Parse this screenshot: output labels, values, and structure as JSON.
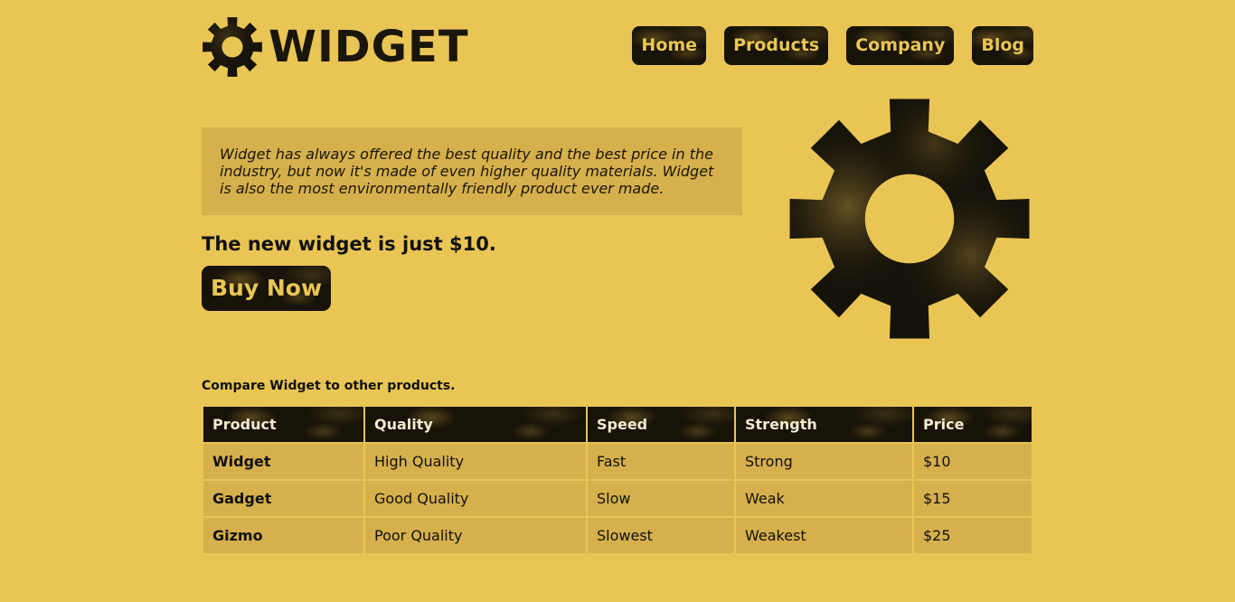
{
  "brand": {
    "name": "WIDGET",
    "color_dark": "#1a160b",
    "color_background": "#e9c555",
    "color_panel": "#d6b04d"
  },
  "nav": {
    "items": [
      {
        "label": "Home"
      },
      {
        "label": "Products"
      },
      {
        "label": "Company"
      },
      {
        "label": "Blog"
      }
    ]
  },
  "intro": {
    "text": "Widget has always offered the best quality and the best price in the industry, but now it's made of even higher quality materials. Widget is also the most environmentally friendly product ever made."
  },
  "promo": {
    "price_line": "The new widget is just $10.",
    "buy_label": "Buy Now"
  },
  "icons": {
    "logo": "gear-icon",
    "hero": "gear-icon"
  },
  "compare": {
    "caption": "Compare Widget to other products.",
    "columns": [
      "Product",
      "Quality",
      "Speed",
      "Strength",
      "Price"
    ],
    "rows": [
      [
        "Widget",
        "High Quality",
        "Fast",
        "Strong",
        "$10"
      ],
      [
        "Gadget",
        "Good Quality",
        "Slow",
        "Weak",
        "$15"
      ],
      [
        "Gizmo",
        "Poor Quality",
        "Slowest",
        "Weakest",
        "$25"
      ]
    ]
  }
}
